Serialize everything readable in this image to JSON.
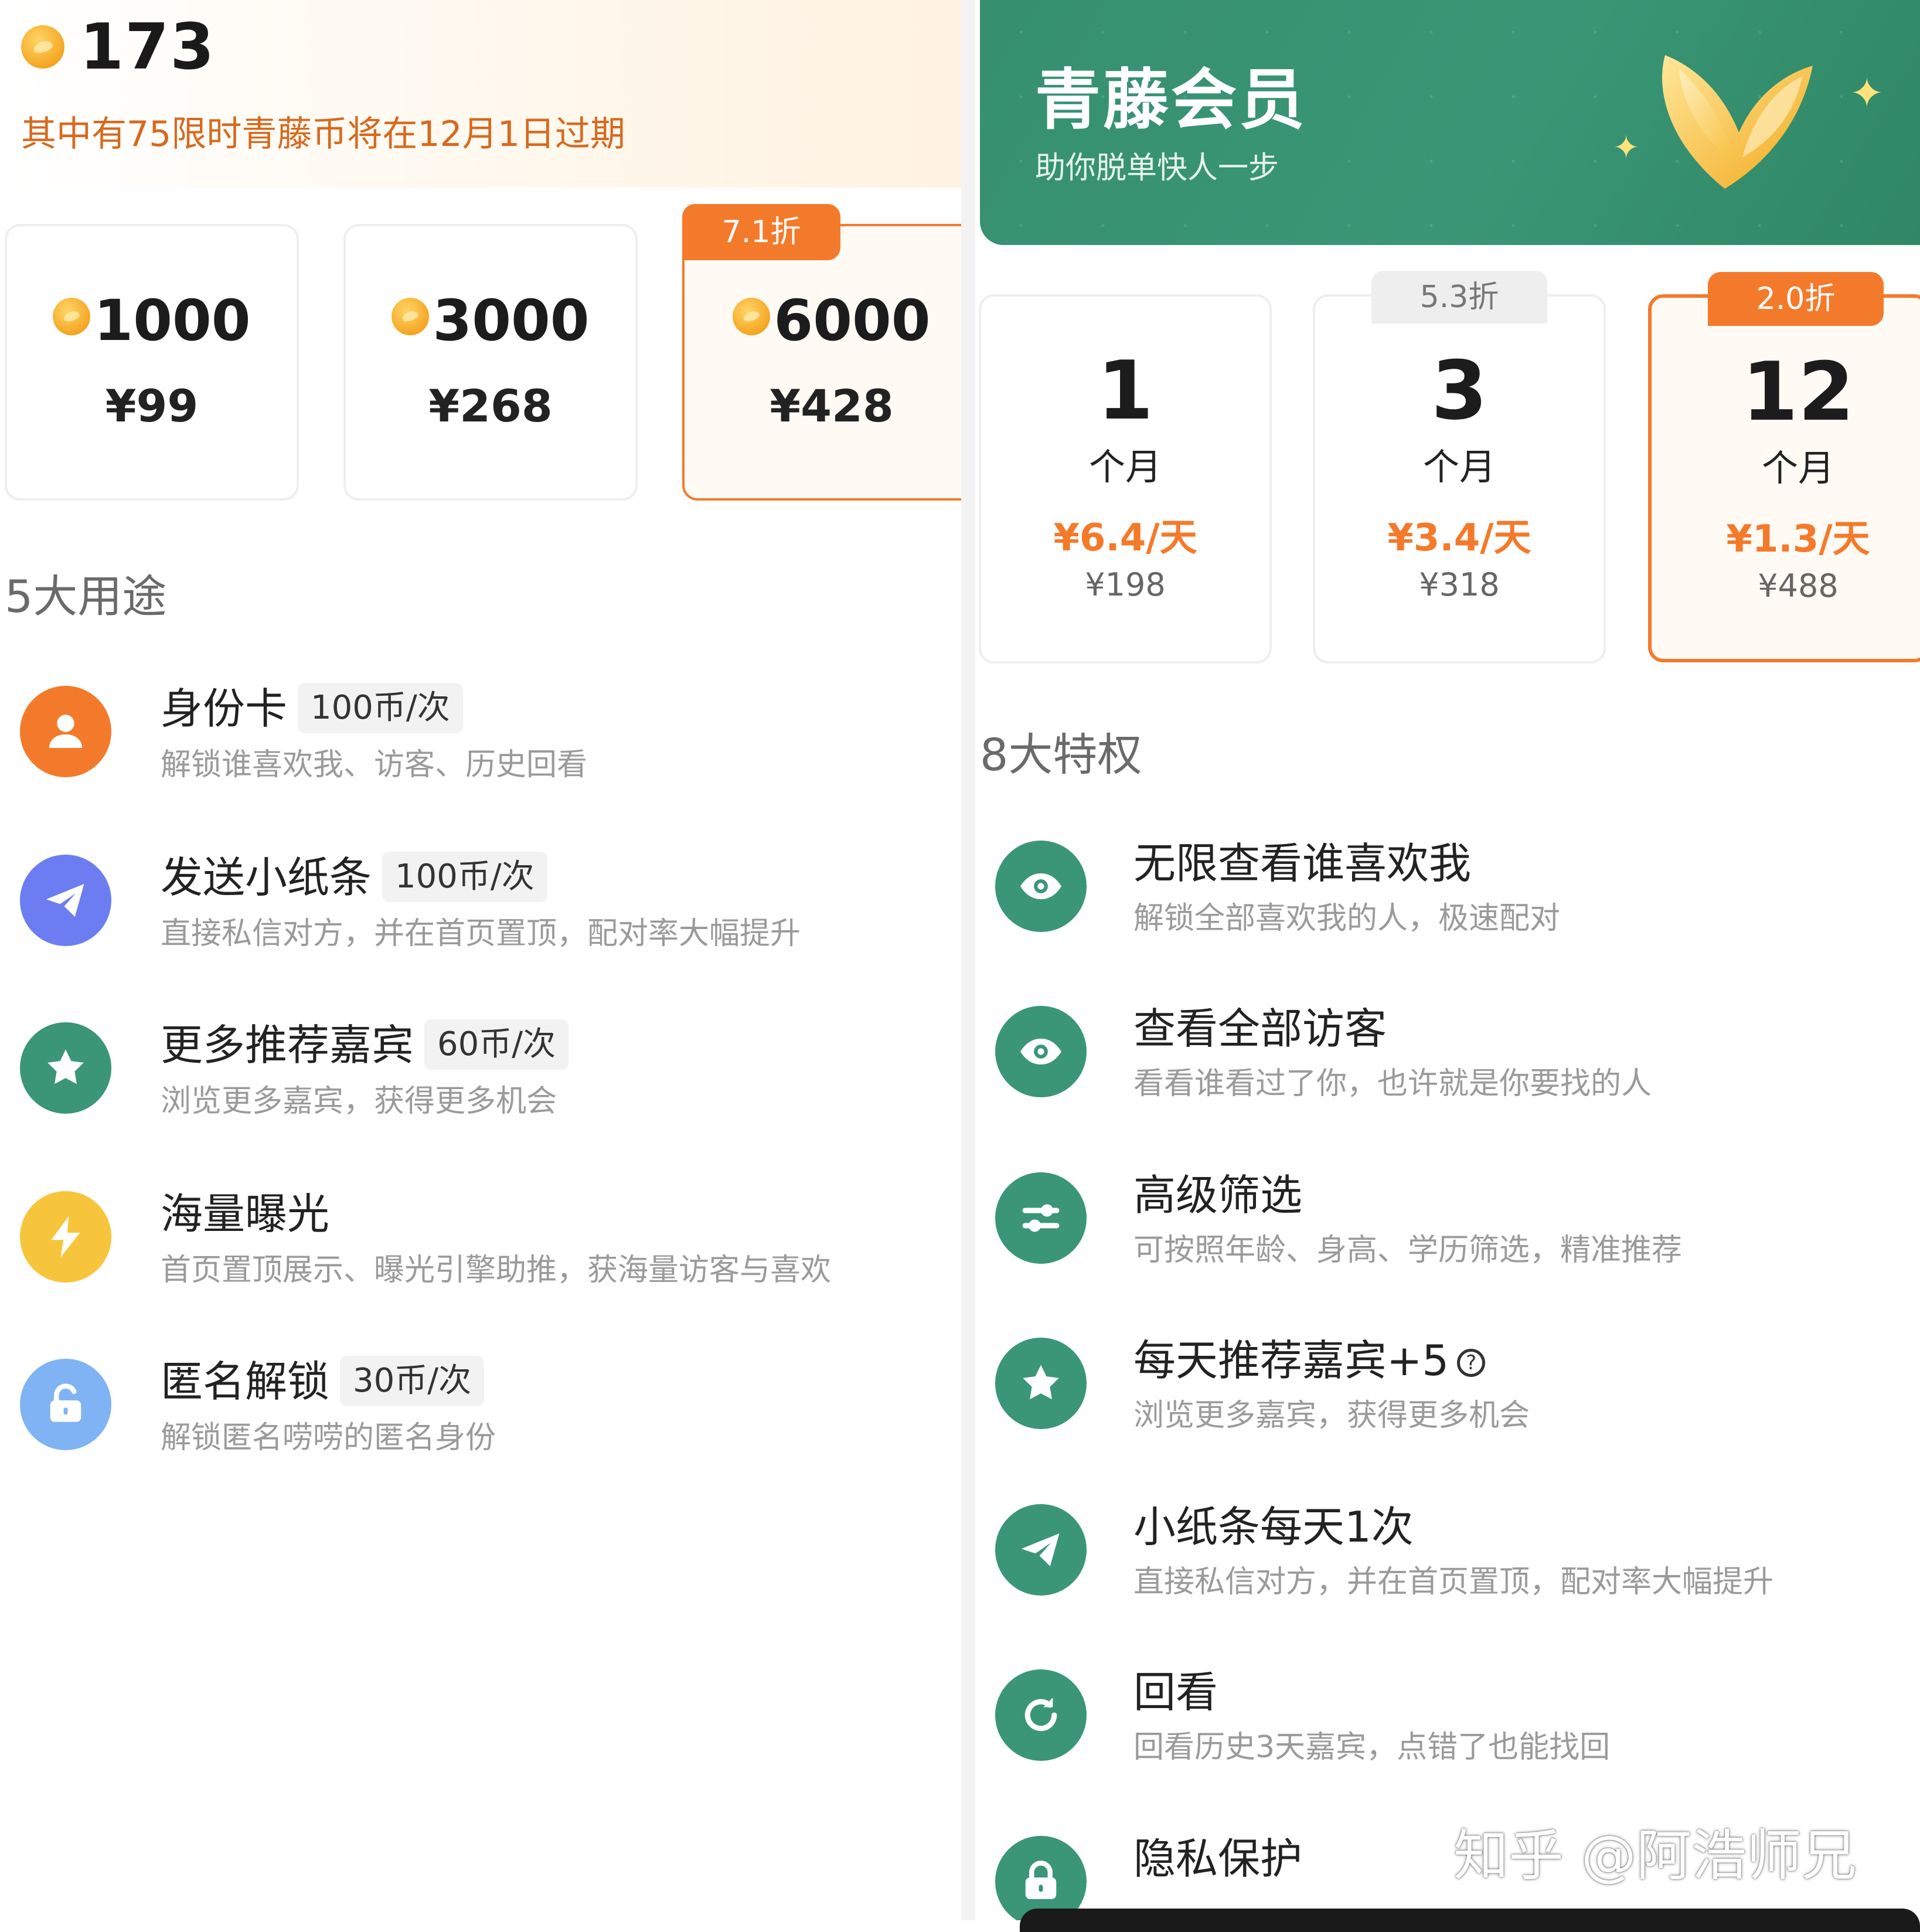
{
  "coins": {
    "balance": "173",
    "expire_notice": "其中有75限时青藤币将在12月1日过期",
    "packages": [
      {
        "amount": "1000",
        "price": "¥99"
      },
      {
        "amount": "3000",
        "price": "¥268"
      },
      {
        "amount": "6000",
        "price": "¥428",
        "badge": "7.1折",
        "selected": true
      }
    ],
    "uses_title": "5大用途",
    "uses": [
      {
        "icon": "user-icon",
        "color": "#f47a2b",
        "title": "身份卡",
        "tag": "100币/次",
        "desc": "解锁谁喜欢我、访客、历史回看"
      },
      {
        "icon": "paper-plane-icon",
        "color": "#6c7df2",
        "title": "发送小纸条",
        "tag": "100币/次",
        "desc": "直接私信对方，并在首页置顶，配对率大幅提升"
      },
      {
        "icon": "star-icon",
        "color": "#3a9676",
        "title": "更多推荐嘉宾",
        "tag": "60币/次",
        "desc": "浏览更多嘉宾，获得更多机会"
      },
      {
        "icon": "lightning-icon",
        "color": "#f7c53c",
        "title": "海量曝光",
        "tag": "",
        "desc": "首页置顶展示、曝光引擎助推，获海量访客与喜欢"
      },
      {
        "icon": "unlock-icon",
        "color": "#7fb3f3",
        "title": "匿名解锁",
        "tag": "30币/次",
        "desc": "解锁匿名唠唠的匿名身份"
      }
    ]
  },
  "vip": {
    "title": "青藤会员",
    "subtitle": "助你脱单快人一步",
    "plans": [
      {
        "months": "1",
        "unit": "个月",
        "daily": "¥6.4/天",
        "total": "¥198"
      },
      {
        "months": "3",
        "unit": "个月",
        "daily": "¥3.4/天",
        "total": "¥318",
        "badge": "5.3折"
      },
      {
        "months": "12",
        "unit": "个月",
        "daily": "¥1.3/天",
        "total": "¥488",
        "badge": "2.0折",
        "selected": true
      }
    ],
    "privileges_title": "8大特权",
    "privileges": [
      {
        "icon": "eye-icon",
        "title": "无限查看谁喜欢我",
        "desc": "解锁全部喜欢我的人，极速配对"
      },
      {
        "icon": "eye-icon",
        "title": "查看全部访客",
        "desc": "看看谁看过了你，也许就是你要找的人"
      },
      {
        "icon": "sliders-icon",
        "title": "高级筛选",
        "desc": "可按照年龄、身高、学历筛选，精准推荐"
      },
      {
        "icon": "star-icon",
        "title": "每天推荐嘉宾+5",
        "desc": "浏览更多嘉宾，获得更多机会",
        "help": "?"
      },
      {
        "icon": "paper-plane-icon",
        "title": "小纸条每天1次",
        "desc": "直接私信对方，并在首页置顶，配对率大幅提升"
      },
      {
        "icon": "refresh-icon",
        "title": "回看",
        "desc": "回看历史3天嘉宾，点错了也能找回"
      },
      {
        "icon": "lock-icon",
        "title": "隐私保护",
        "desc": ""
      }
    ],
    "accent": "#3a9676"
  },
  "watermark": "知乎 @阿浩师兄",
  "colors": {
    "orange": "#f47a2b",
    "green": "#3a9676"
  }
}
